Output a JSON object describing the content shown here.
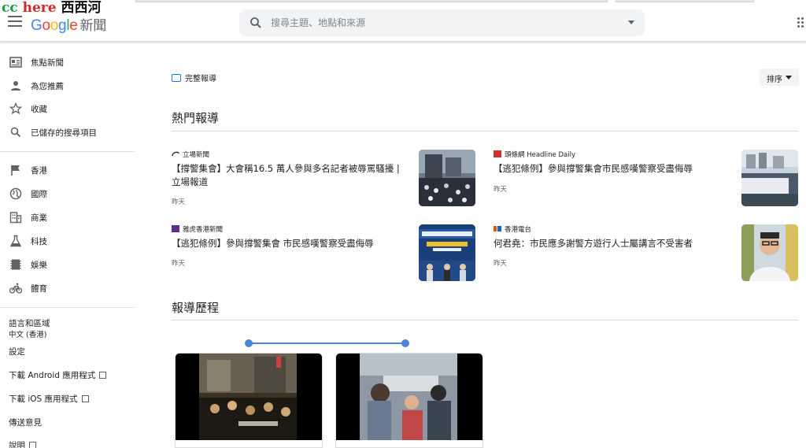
{
  "watermark": {
    "part1": "cc",
    "part2": "here",
    "part3": "西西河"
  },
  "header": {
    "logo_letters": [
      "G",
      "o",
      "o",
      "g",
      "l",
      "e"
    ],
    "product": "新聞",
    "search_placeholder": "搜尋主題、地點和來源"
  },
  "sidebar": {
    "main_items": [
      {
        "label": "焦點新聞",
        "icon": "newspaper-icon"
      },
      {
        "label": "為您推薦",
        "icon": "person-icon"
      },
      {
        "label": "收藏",
        "icon": "star-icon"
      },
      {
        "label": "已儲存的搜尋項目",
        "icon": "search-icon"
      }
    ],
    "topic_items": [
      {
        "label": "香港",
        "icon": "flag-icon"
      },
      {
        "label": "國際",
        "icon": "globe-icon"
      },
      {
        "label": "商業",
        "icon": "building-icon"
      },
      {
        "label": "科技",
        "icon": "flask-icon"
      },
      {
        "label": "娛樂",
        "icon": "film-icon"
      },
      {
        "label": "體育",
        "icon": "bicycle-icon"
      }
    ],
    "language_label": "語言和區域",
    "language_value": "中文 (香港)",
    "settings": "設定",
    "android_app": "下載 Android 應用程式",
    "ios_app": "下載 iOS 應用程式",
    "feedback": "傳送意見",
    "help": "說明"
  },
  "main": {
    "full_coverage": "完整報導",
    "sort_label": "排序",
    "section_top": "熱門報導",
    "section_timeline": "報導歷程",
    "stories": [
      {
        "source": "立場新聞",
        "headline": "【撐警集會】大會稱16.5 萬人參與多名記者被辱罵騷擾 | 立場報道",
        "time": "昨天"
      },
      {
        "source": "頭條網 Headline Daily",
        "headline": "【逃犯條例】參與撐警集會市民感嘆警察受盡侮辱",
        "time": "昨天"
      },
      {
        "source": "雅虎香港新聞",
        "headline": "【逃犯條例】參與撐警集會 市民感嘆警察受盡侮辱",
        "time": "昨天"
      },
      {
        "source": "香港電台",
        "headline": "何君堯：市民應多謝警方遊行人士屬講言不受害者",
        "time": "昨天"
      }
    ]
  },
  "colors": {
    "accent": "#1a73e8",
    "timeline": "#4a86d8"
  }
}
